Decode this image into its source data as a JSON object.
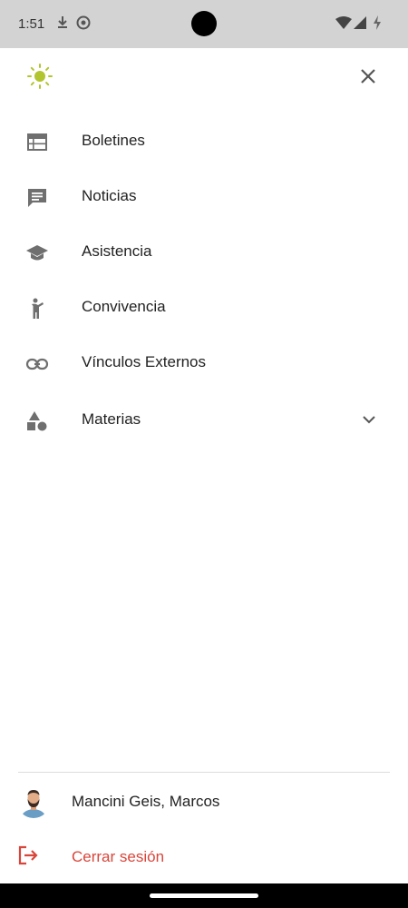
{
  "status_bar": {
    "time": "1:51"
  },
  "drawer": {
    "menu": [
      {
        "label": "Boletines",
        "icon": "table-icon"
      },
      {
        "label": "Noticias",
        "icon": "message-icon"
      },
      {
        "label": "Asistencia",
        "icon": "school-icon"
      },
      {
        "label": "Convivencia",
        "icon": "person-icon"
      },
      {
        "label": "Vínculos Externos",
        "icon": "link-icon"
      },
      {
        "label": "Materias",
        "icon": "shapes-icon",
        "expandable": true
      }
    ],
    "user": {
      "name": "Mancini Geis, Marcos"
    },
    "logout_label": "Cerrar sesión"
  },
  "colors": {
    "accent_sun": "#b2c42e",
    "icon_gray": "#6f6f6f",
    "logout": "#d9453a",
    "status_bar": "#d3d3d3"
  }
}
